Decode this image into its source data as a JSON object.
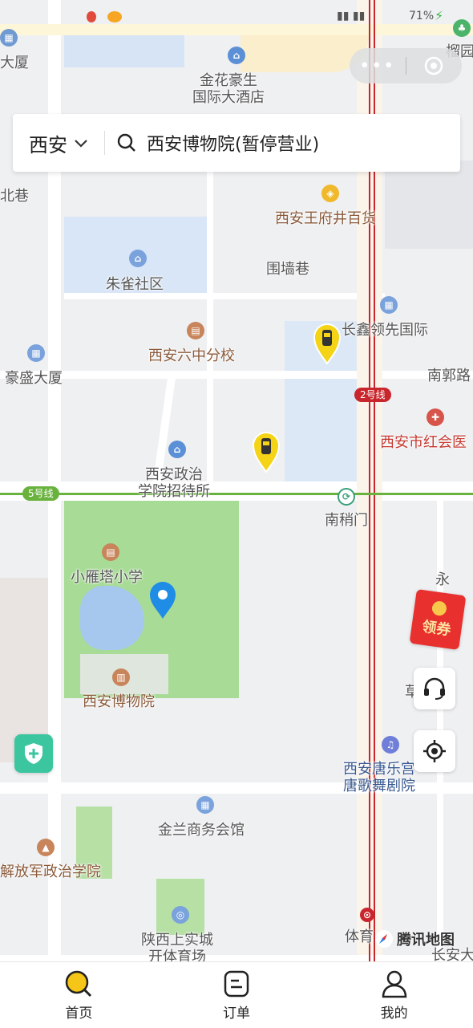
{
  "status_bar": {
    "battery": "71%"
  },
  "capsule": {
    "dots": "•••"
  },
  "search": {
    "city": "西安",
    "query": "西安博物院(暂停营业)"
  },
  "map_labels": {
    "top_left_building": "大厦",
    "hotel": "金花豪生\n国际大酒店",
    "top_right_park": "榴园",
    "lane_left": "北巷",
    "department_store": "西安王府井百货",
    "zhuque": "朱雀社区",
    "weiqiang_lane": "围墙巷",
    "changxin": "长鑫领先国际",
    "school6": "西安六中分校",
    "haosheng": "豪盛大厦",
    "nanguo_road": "南郭路",
    "line2": "2号线",
    "redcross": "西安市红会医",
    "politics_college": "西安政治\n学院招待所",
    "line5": "5号线",
    "nanshaomen": "南稍门",
    "xiaoyanta_school": "小雁塔小学",
    "yong": "永",
    "museum": "西安博物院",
    "cao": "草",
    "tanglegong": "西安唐乐宫\n唐歌舞剧院",
    "jinlan": "金兰商务会馆",
    "pla_college": "解放军政治学院",
    "shangshi_city": "陕西上实城\n开体育场",
    "tiyu": "体育",
    "tencent_map": "腾讯地图",
    "changan": "长安大"
  },
  "coupon": {
    "label": "领券"
  },
  "tabs": [
    {
      "label": "首页",
      "icon": "search-icon"
    },
    {
      "label": "订单",
      "icon": "order-icon"
    },
    {
      "label": "我的",
      "icon": "user-icon"
    }
  ],
  "colors": {
    "accent": "#f5c518",
    "metro2": "#c8262c",
    "metro5": "#6ab23e",
    "park": "#a8dc96",
    "water": "#d6e4f5"
  }
}
